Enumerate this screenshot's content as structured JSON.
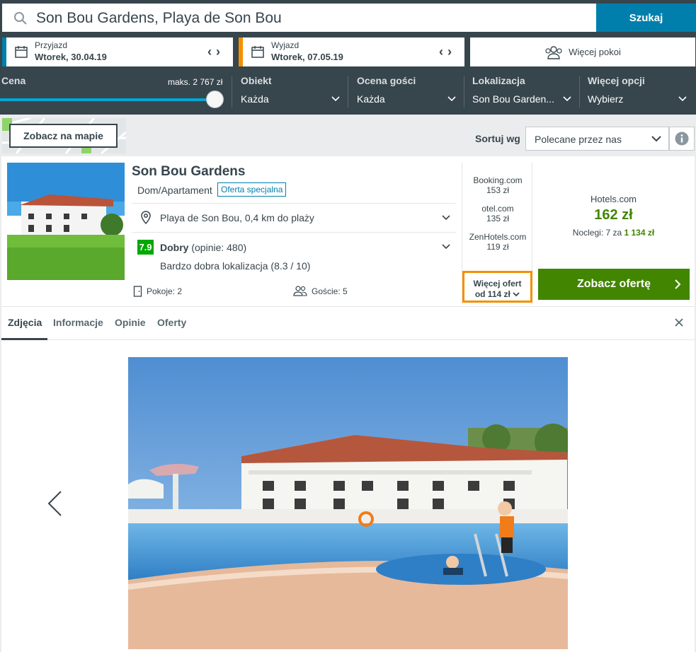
{
  "search": {
    "value": "Son Bou Gardens, Playa de Son Bou",
    "button": "Szukaj"
  },
  "checkin": {
    "label": "Przyjazd",
    "value": "Wtorek, 30.04.19"
  },
  "checkout": {
    "label": "Wyjazd",
    "value": "Wtorek, 07.05.19"
  },
  "rooms": {
    "label": "Więcej pokoi"
  },
  "filters": {
    "price": {
      "label": "Cena",
      "max": "maks. 2 767 zł",
      "level_fraction": 1.0
    },
    "object": {
      "label": "Obiekt",
      "value": "Każda"
    },
    "guest_rating": {
      "label": "Ocena gości",
      "value": "Każda"
    },
    "location": {
      "label": "Lokalizacja",
      "value": "Son Bou Garden..."
    },
    "more": {
      "label": "Więcej opcji",
      "value": "Wybierz"
    }
  },
  "map_button": "Zobacz na mapie",
  "sort": {
    "label": "Sortuj wg",
    "value": "Polecane przez nas"
  },
  "hotel": {
    "name": "Son Bou Gardens",
    "type": "Dom/Apartament",
    "badge": "Oferta specjalna",
    "location": "Playa de Son Bou, 0,4 km do plaży",
    "score": "7.9",
    "rating_word": "Dobry",
    "rating_count": "(opinie: 480)",
    "rating_detail": "Bardzo dobra lokalizacja (8.3 / 10)",
    "rooms": "Pokoje: 2",
    "guests": "Goście: 5"
  },
  "offers": [
    {
      "site": "Booking.com",
      "price": "153 zł"
    },
    {
      "site": "otel.com",
      "price": "135 zł"
    },
    {
      "site": "ZenHotels.com",
      "price": "119 zł"
    }
  ],
  "more_offers": {
    "line1": "Więcej ofert",
    "line2": "od 114 zł"
  },
  "best_offer": {
    "provider": "Hotels.com",
    "price": "162 zł",
    "nights_prefix": "Noclegi: 7 za ",
    "total": "1 134 zł",
    "cta": "Zobacz ofertę"
  },
  "tabs": [
    "Zdjęcia",
    "Informacje",
    "Opinie",
    "Oferty"
  ],
  "colors": {
    "header": "#37454d",
    "accent_blue": "#007fad",
    "accent_orange": "#f48f00",
    "green": "#428500",
    "score_green": "#00a800"
  }
}
